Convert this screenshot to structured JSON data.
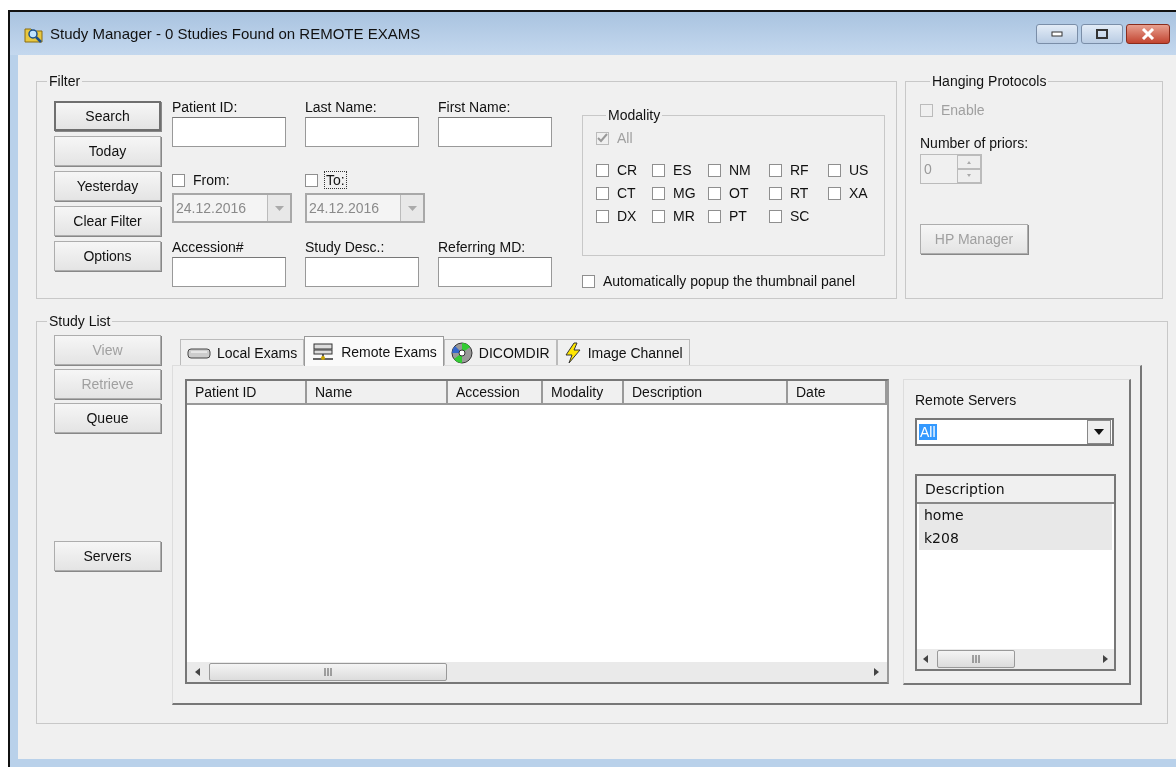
{
  "window": {
    "title": "Study Manager - 0 Studies Found on REMOTE EXAMS"
  },
  "filter": {
    "title": "Filter",
    "buttons": [
      {
        "label": "Search",
        "default": true
      },
      {
        "label": "Today",
        "default": false
      },
      {
        "label": "Yesterday",
        "default": false
      },
      {
        "label": "Clear Filter",
        "default": false
      },
      {
        "label": "Options",
        "default": false
      }
    ],
    "text_fields_top": [
      {
        "label": "Patient ID:"
      },
      {
        "label": "Last Name:"
      },
      {
        "label": "First Name:"
      }
    ],
    "dates": [
      {
        "label": "From:",
        "checked": false,
        "focused": false,
        "value": "24.12.2016",
        "disabled": true
      },
      {
        "label": "To:",
        "checked": false,
        "focused": true,
        "value": "24.12.2016",
        "disabled": true
      }
    ],
    "text_fields_bottom": [
      {
        "label": "Accession#"
      },
      {
        "label": "Study Desc.:"
      },
      {
        "label": "Referring MD:"
      }
    ],
    "modality": {
      "title": "Modality",
      "all": {
        "label": "All",
        "checked": true,
        "disabled": true
      },
      "options": [
        {
          "label": "CR",
          "checked": false
        },
        {
          "label": "ES",
          "checked": false
        },
        {
          "label": "NM",
          "checked": false
        },
        {
          "label": "RF",
          "checked": false
        },
        {
          "label": "US",
          "checked": false
        },
        {
          "label": "CT",
          "checked": false
        },
        {
          "label": "MG",
          "checked": false
        },
        {
          "label": "OT",
          "checked": false
        },
        {
          "label": "RT",
          "checked": false
        },
        {
          "label": "XA",
          "checked": false
        },
        {
          "label": "DX",
          "checked": false
        },
        {
          "label": "MR",
          "checked": false
        },
        {
          "label": "PT",
          "checked": false
        },
        {
          "label": "SC",
          "checked": false
        }
      ]
    },
    "auto_popup": {
      "label": "Automatically popup the thumbnail panel",
      "checked": false
    }
  },
  "hanging_protocols": {
    "title": "Hanging Protocols",
    "enable": {
      "label": "Enable",
      "checked": false,
      "disabled": true
    },
    "priors_label": "Number of priors:",
    "priors_value": "0",
    "priors_disabled": true,
    "hp_button": {
      "label": "HP Manager",
      "disabled": true
    }
  },
  "study_list": {
    "title": "Study List",
    "buttons": [
      {
        "label": "View",
        "disabled": true
      },
      {
        "label": "Retrieve",
        "disabled": true
      },
      {
        "label": "Queue",
        "disabled": false
      }
    ],
    "servers_button": {
      "label": "Servers",
      "disabled": false
    },
    "tabs": [
      {
        "label": "Local Exams",
        "kind": "drive",
        "selected": false
      },
      {
        "label": "Remote Exams",
        "kind": "network",
        "selected": true
      },
      {
        "label": "DICOMDIR",
        "kind": "disc",
        "selected": false
      },
      {
        "label": "Image Channel",
        "kind": "bolt",
        "selected": false
      }
    ],
    "table": {
      "columns": [
        "Patient ID",
        "Name",
        "Accession",
        "Modality",
        "Description",
        "Date"
      ]
    },
    "remote_servers": {
      "title": "Remote Servers",
      "dropdown_value": "All",
      "list_header": "Description",
      "rows": [
        {
          "text": "home",
          "selected": true
        },
        {
          "text": "k208",
          "selected": true
        }
      ]
    }
  }
}
